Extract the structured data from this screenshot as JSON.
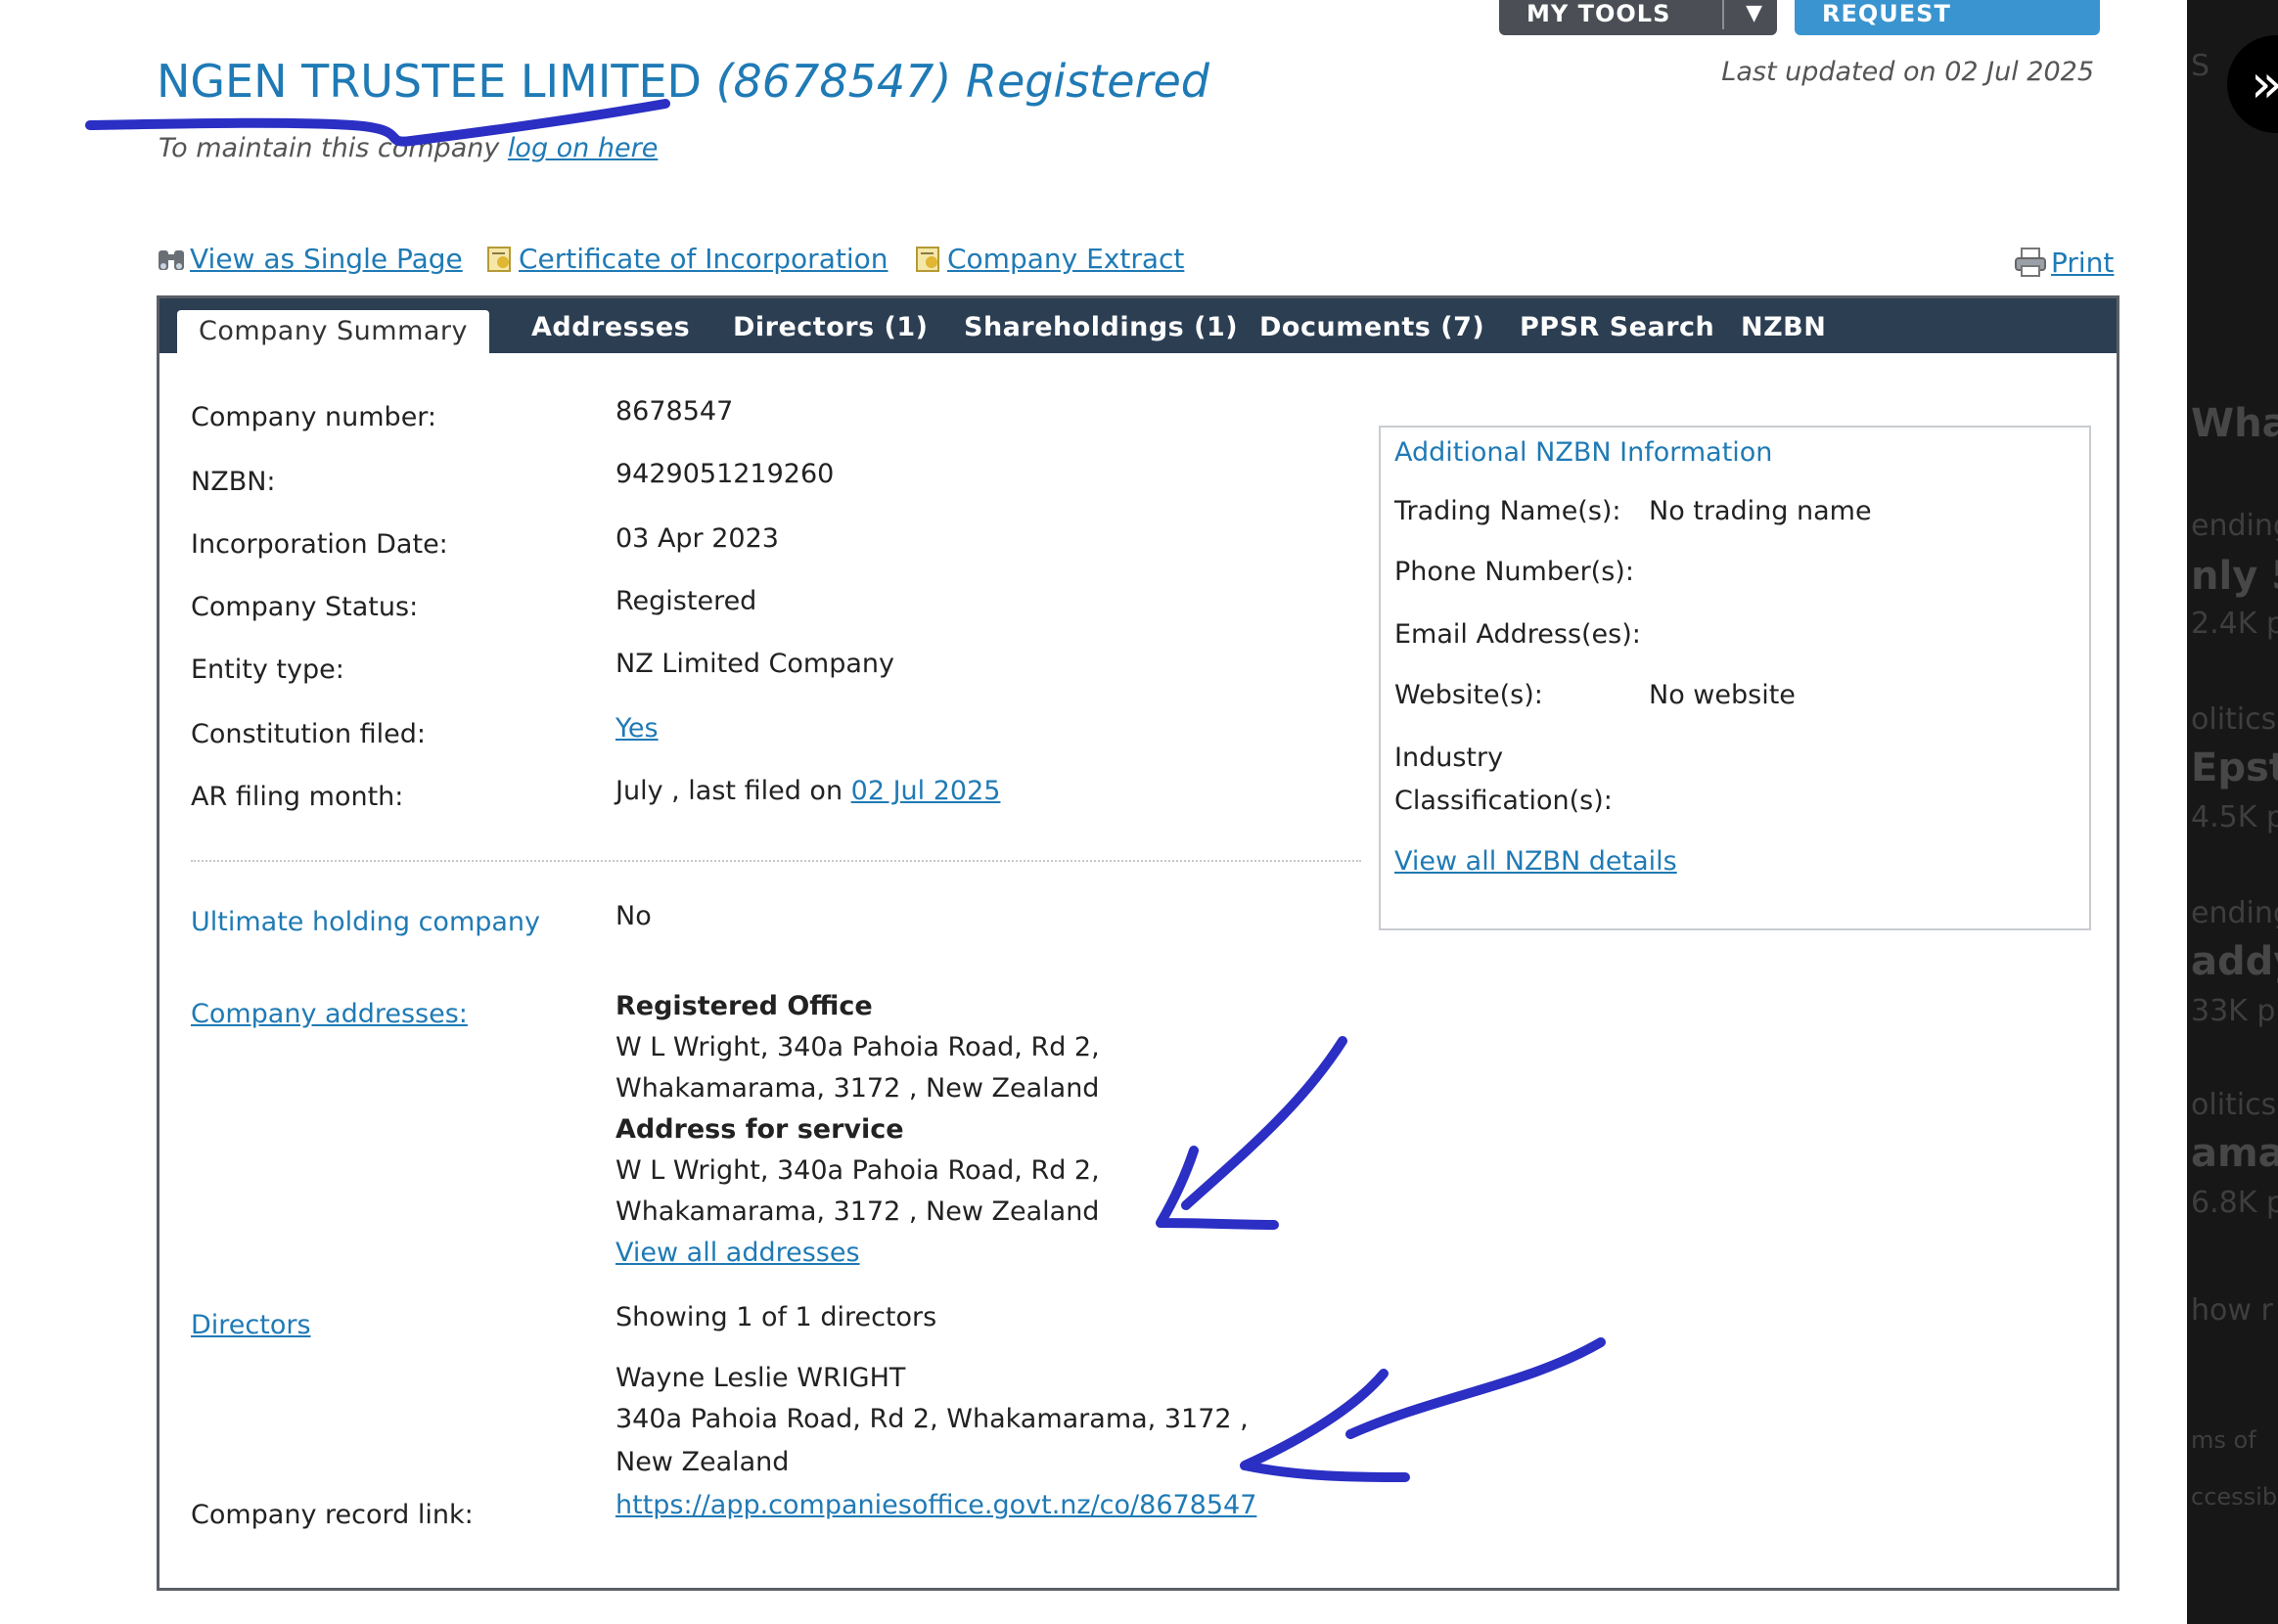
{
  "toolbar": {
    "my_tools": "MY TOOLS",
    "caret": "▼",
    "request_authority": "REQUEST AUTHORITY »"
  },
  "last_updated": "Last updated on 02 Jul 2025",
  "company": {
    "name": "NGEN TRUSTEE LIMITED",
    "number_paren": "(8678547)",
    "status_title": "Registered",
    "maintain_prefix": "To maintain this company ",
    "maintain_link": "log on here"
  },
  "actions": {
    "single_page": "View as Single Page",
    "certificate": "Certificate of Incorporation",
    "extract": "Company Extract",
    "print": "Print"
  },
  "tabs": [
    {
      "label": "Company Summary"
    },
    {
      "label": "Addresses"
    },
    {
      "label": "Directors (1)"
    },
    {
      "label": "Shareholdings (1)"
    },
    {
      "label": "Documents (7)"
    },
    {
      "label": "PPSR Search"
    },
    {
      "label": "NZBN"
    }
  ],
  "summary": {
    "company_number_label": "Company number:",
    "company_number": "8678547",
    "nzbn_label": "NZBN:",
    "nzbn": "9429051219260",
    "incorporation_label": "Incorporation Date:",
    "incorporation": "03 Apr 2023",
    "status_label": "Company Status:",
    "status": "Registered",
    "entity_label": "Entity type:",
    "entity": "NZ Limited Company",
    "constitution_label": "Constitution filed:",
    "constitution": "Yes",
    "ar_label": "AR filing month:",
    "ar_prefix": "July , last filed on ",
    "ar_link": "02 Jul 2025",
    "holding_label": "Ultimate holding company",
    "holding": "No",
    "addresses_label": "Company addresses:",
    "registered_office_heading": "Registered Office",
    "registered_office_line1": "W L Wright, 340a Pahoia Road, Rd 2,",
    "registered_office_line2": "Whakamarama, 3172 , New Zealand",
    "service_heading": "Address for service",
    "service_line1": "W L Wright, 340a Pahoia Road, Rd 2,",
    "service_line2": "Whakamarama, 3172 , New Zealand",
    "view_all_addresses": "View all addresses",
    "directors_label": "Directors",
    "directors_showing": "Showing 1 of 1 directors",
    "director_name": "Wayne Leslie WRIGHT",
    "director_line1": "340a Pahoia Road, Rd 2, Whakamarama, 3172 ,",
    "director_line2": "New Zealand",
    "record_link_label": "Company record link:",
    "record_link": "https://app.companiesoffice.govt.nz/co/8678547"
  },
  "nzbn_box": {
    "title": "Additional NZBN Information",
    "trading_label": "Trading Name(s):",
    "trading": "No trading name",
    "phone_label": "Phone Number(s):",
    "email_label": "Email Address(es):",
    "website_label": "Website(s):",
    "website": "No website",
    "industry_label1": "Industry",
    "industry_label2": "Classification(s):",
    "view_all": "View all NZBN details"
  },
  "background_strip": {
    "frag1": "S",
    "frag2": "What",
    "frag3": "ending",
    "frag4": "nly 5",
    "frag5": "2.4K p",
    "frag6": "olitics",
    "frag7": "Epste",
    "frag8": "4.5K p",
    "frag9": "ending",
    "frag10": "addy",
    "frag11": "33K p",
    "frag12": "olitics",
    "frag13": "amal",
    "frag14": "6.8K p",
    "frag15": "how r",
    "frag16": "ms of",
    "frag17": "ccessib"
  },
  "colors": {
    "link": "#1f7ab5",
    "tabbar": "#2c3e52",
    "annotation": "#2b2fc4"
  }
}
